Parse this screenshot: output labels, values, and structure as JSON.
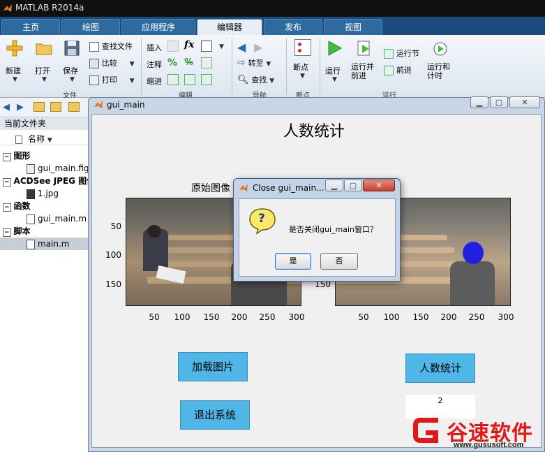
{
  "app": {
    "title": "MATLAB R2014a"
  },
  "tabs": [
    {
      "label": "主页"
    },
    {
      "label": "绘图"
    },
    {
      "label": "应用程序"
    },
    {
      "label": "编辑器"
    },
    {
      "label": "发布"
    },
    {
      "label": "视图"
    }
  ],
  "ribbon": {
    "new_label": "新建",
    "open_label": "打开",
    "save_label": "保存",
    "find_files": "查找文件",
    "compare": "比较",
    "print": "打印",
    "group_file": "文件",
    "insert": "插入",
    "comment": "注释",
    "indent": "缩进",
    "group_edit": "编辑",
    "goto": "转至",
    "find": "查找",
    "group_nav": "导航",
    "breakpoint": "断点",
    "group_bp": "断点",
    "run": "运行",
    "run_advance": "运行并\n前进",
    "run_section": "运行节",
    "advance": "前进",
    "run_time": "运行和\n计时",
    "group_run": "运行"
  },
  "leftpanel": {
    "header": "当前文件夹",
    "col_name": "名称",
    "items": [
      {
        "label": "图形"
      },
      {
        "label": "gui_main.fig"
      },
      {
        "label": "ACDSee JPEG 图像"
      },
      {
        "label": "1.jpg"
      },
      {
        "label": "函数"
      },
      {
        "label": "gui_main.m"
      },
      {
        "label": "脚本"
      },
      {
        "label": "main.m"
      }
    ]
  },
  "gui": {
    "window_title": "gui_main",
    "heading": "人数统计",
    "orig_label": "原始图像",
    "y_ticks": [
      "50",
      "100",
      "150"
    ],
    "x_ticks": [
      "50",
      "100",
      "150",
      "200",
      "250",
      "300"
    ],
    "load_button": "加载图片",
    "exit_button": "退出系统",
    "count_button": "人数统计",
    "count_result": "2"
  },
  "dialog": {
    "title": "Close gui_main...",
    "question": "是否关闭gui_main窗口？",
    "yes": "是",
    "no": "否",
    "q_icon": "?"
  },
  "watermark": {
    "text": "谷速软件",
    "url": "www.gususoft.com"
  },
  "colors": {
    "accent_blue": "#4fb7e8",
    "watermark_red": "#e01818"
  }
}
